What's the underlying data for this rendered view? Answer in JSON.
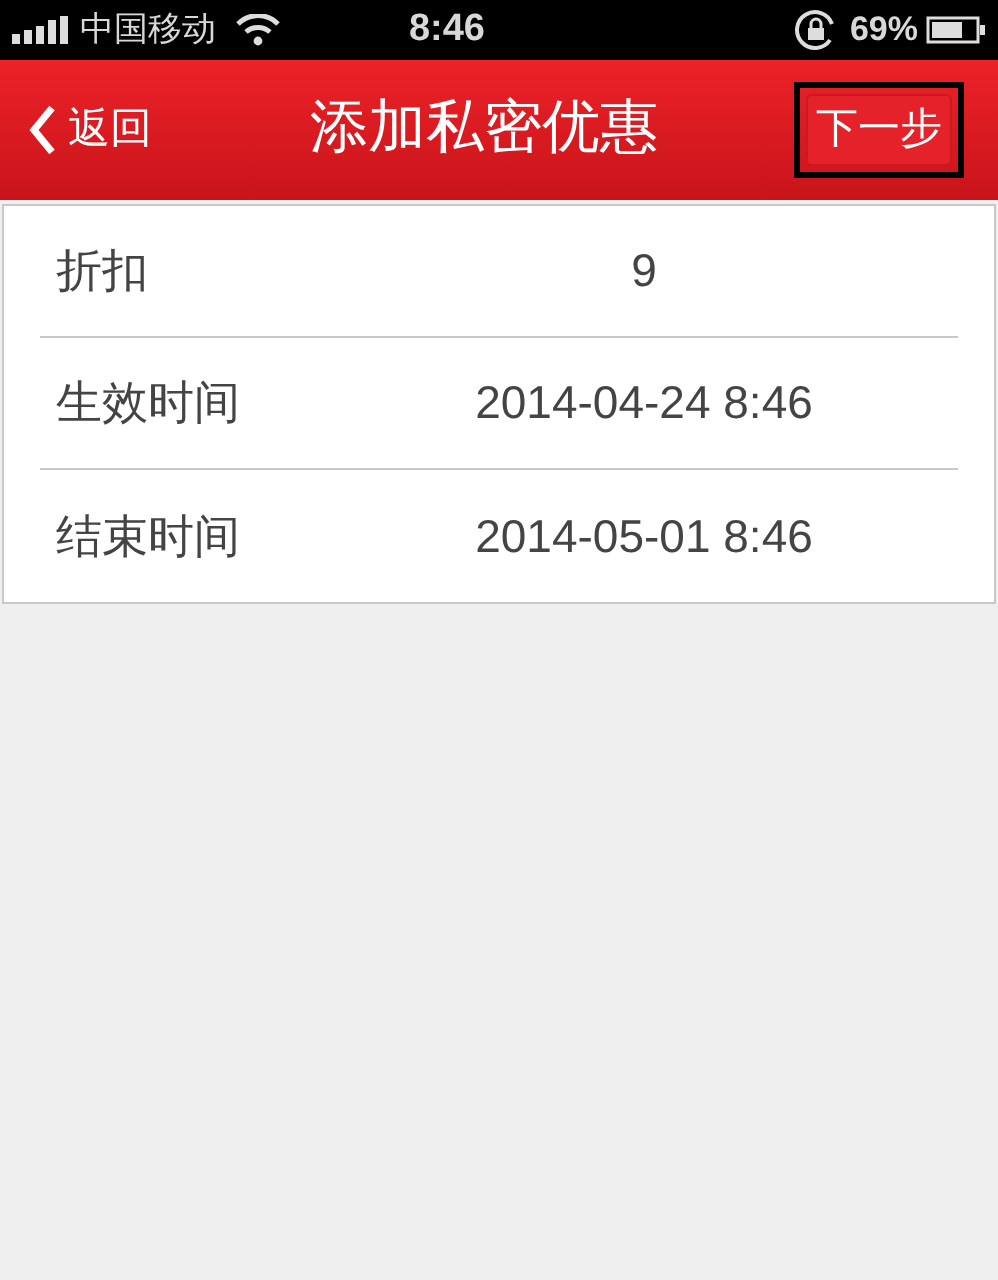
{
  "status_bar": {
    "carrier": "中国移动",
    "time": "8:46",
    "battery": "69%"
  },
  "nav_bar": {
    "back": "返回",
    "title": "添加私密优惠",
    "next": "下一步"
  },
  "rows": [
    {
      "label": "折扣",
      "value": "9"
    },
    {
      "label": "生效时间",
      "value": "2014-04-24 8:46"
    },
    {
      "label": "结束时间",
      "value": "2014-05-01 8:46"
    }
  ]
}
